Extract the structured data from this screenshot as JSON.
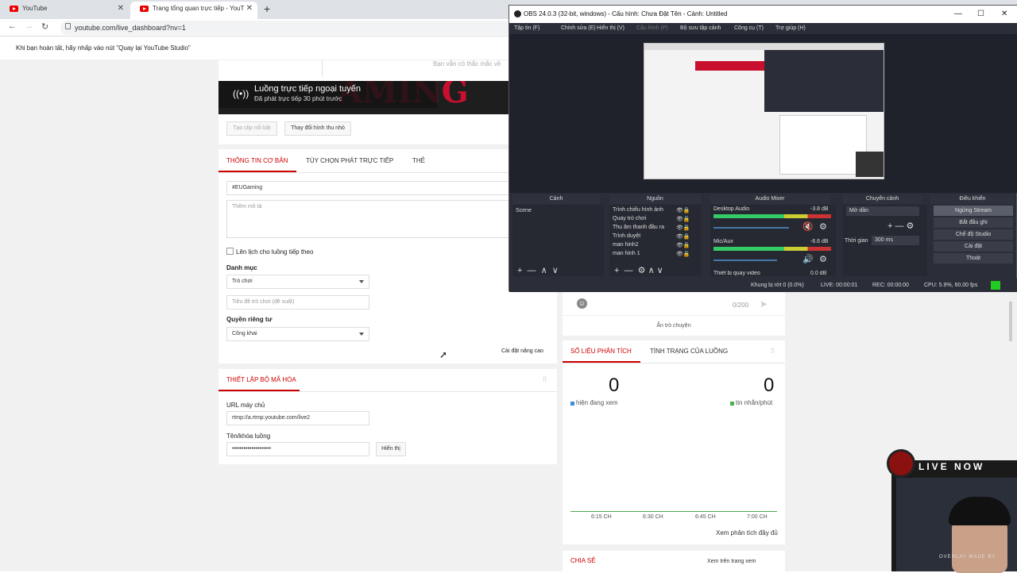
{
  "browser": {
    "tabs": [
      {
        "title": "YouTube"
      },
      {
        "title": "Trang tổng quan trực tiếp - YouT"
      }
    ],
    "url": "youtube.com/live_dashboard?nv=1"
  },
  "banner": "Khi bạn hoàn tất, hãy nhấp vào nút \"Quay lại YouTube Studio\"",
  "faded_hint": "Bạn vẫn có thắc mắc về",
  "stream": {
    "title": "Luồng trực tiếp ngoại tuyến",
    "subtitle": "Đã phát trực tiếp 30 phút trước",
    "bg_text": "AMING",
    "clip_btn": "Tạo clip nổi bật",
    "thumb_btn": "Thay đổi hình thu nhỏ"
  },
  "info_tabs": [
    "THÔNG TIN CƠ BẢN",
    "TÙY CHỌN PHÁT TRỰC TIẾP",
    "THẺ"
  ],
  "form": {
    "title_value": "#EUGaming",
    "desc_placeholder": "Thêm mô tả",
    "schedule_label": "Lên lịch cho luồng tiếp theo",
    "category_label": "Danh mục",
    "category_value": "Trò chơi",
    "game_placeholder": "Tiêu đề trò chơi (đề xuất)",
    "privacy_label": "Quyền riêng tư",
    "privacy_value": "Công khai",
    "advanced": "Cài đặt nâng cao"
  },
  "encoder": {
    "title": "THIẾT LẬP BỘ MÃ HÓA",
    "server_label": "URL máy chủ",
    "server_value": "rtmp://a.rtmp.youtube.com/live2",
    "key_label": "Tên/khóa luồng",
    "key_value": "••••••••••••••••••••",
    "show_btn": "Hiển thị"
  },
  "chat": {
    "counter": "0/200",
    "hide": "Ẩn trò chuyện"
  },
  "analytics": {
    "tabs": [
      "SỐ LIỆU PHÂN TÍCH",
      "TÌNH TRẠNG CỦA LUỒNG"
    ],
    "viewers": "0",
    "viewers_label": "hiện đang xem",
    "messages": "0",
    "messages_label": "tin nhắn/phút",
    "times": [
      "6:15 CH",
      "6:30 CH",
      "6:45 CH",
      "7:00 CH"
    ],
    "full_link": "Xem phân tích đầy đủ",
    "share": "CHIA SẺ",
    "watch_link": "Xem trên trang xem"
  },
  "obs": {
    "title": "OBS 24.0.3 (32-bit, windows) - Cấu hình: Chưa Đặt Tên - Cảnh: Untitled",
    "menu": [
      "Tập tin (F)",
      "Chỉnh sửa (E)",
      "Hiển thị (V)",
      "Cấu hình (P)",
      "Bộ sưu tập cảnh",
      "Công cụ (T)",
      "Trợ giúp (H)"
    ],
    "docks": [
      "Cảnh",
      "Nguồn",
      "Audio Mixer",
      "Chuyển cảnh",
      "Điều khiển"
    ],
    "scene": "Scene",
    "sources": [
      "Trình chiếu hình ảnh",
      "Quay trò chơi",
      "Thu âm thanh đầu ra",
      "Trình duyệt",
      "man hinh2",
      "man hinh 1"
    ],
    "mixer": [
      {
        "name": "Desktop Audio",
        "db": "-3.8 dB"
      },
      {
        "name": "Mic/Aux",
        "db": "-6.6 dB"
      },
      {
        "name": "Thiết bị quay video",
        "db": "0.0 dB"
      }
    ],
    "transition": "Mờ dần",
    "duration_label": "Thời gian",
    "duration": "300 ms",
    "controls": [
      "Ngừng Stream",
      "Bắt đầu ghi",
      "Chế độ Studio",
      "Cài đặt",
      "Thoát"
    ],
    "status": {
      "dropped": "Khung bị rớt 0 (0.0%)",
      "live": "LIVE: 00:00:01",
      "rec": "REC: 00:00:00",
      "cpu": "CPU: 5.9%, 60.00 fps"
    }
  },
  "overlay": {
    "live": "LIVE NOW",
    "credit": "OVERLAY MADE BY"
  },
  "colors": {
    "accent": "#cc0000",
    "obs_bg": "#2b2e38",
    "status_green": "#22cc22"
  }
}
